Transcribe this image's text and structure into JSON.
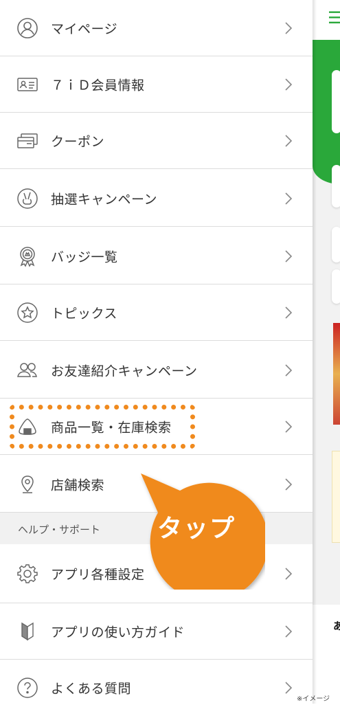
{
  "menu": {
    "items": [
      {
        "label": "マイページ",
        "icon": "person-circle-icon"
      },
      {
        "label": "７ｉＤ会員情報",
        "icon": "id-card-icon"
      },
      {
        "label": "クーポン",
        "icon": "coupon-icon"
      },
      {
        "label": "抽選キャンペーン",
        "icon": "peace-hand-icon"
      },
      {
        "label": "バッジ一覧",
        "icon": "badge-icon"
      },
      {
        "label": "トピックス",
        "icon": "star-circle-icon"
      },
      {
        "label": "お友達紹介キャンペーン",
        "icon": "friends-icon"
      },
      {
        "label": "商品一覧・在庫検索",
        "icon": "onigiri-icon"
      },
      {
        "label": "店舗検索",
        "icon": "location-pin-icon"
      }
    ],
    "section_header": "ヘルプ・サポート",
    "help_items": [
      {
        "label": "アプリ各種設定",
        "icon": "gear-icon"
      },
      {
        "label": "アプリの使い方ガイド",
        "icon": "beginner-mark-icon"
      },
      {
        "label": "よくある質問",
        "icon": "question-circle-icon"
      }
    ]
  },
  "annotation": {
    "tap_label": "タップ",
    "note": "※イメージ"
  },
  "background": {
    "footer_char": "あ"
  },
  "colors": {
    "accent_orange": "#f08a1e",
    "brand_green": "#2aa83a"
  }
}
